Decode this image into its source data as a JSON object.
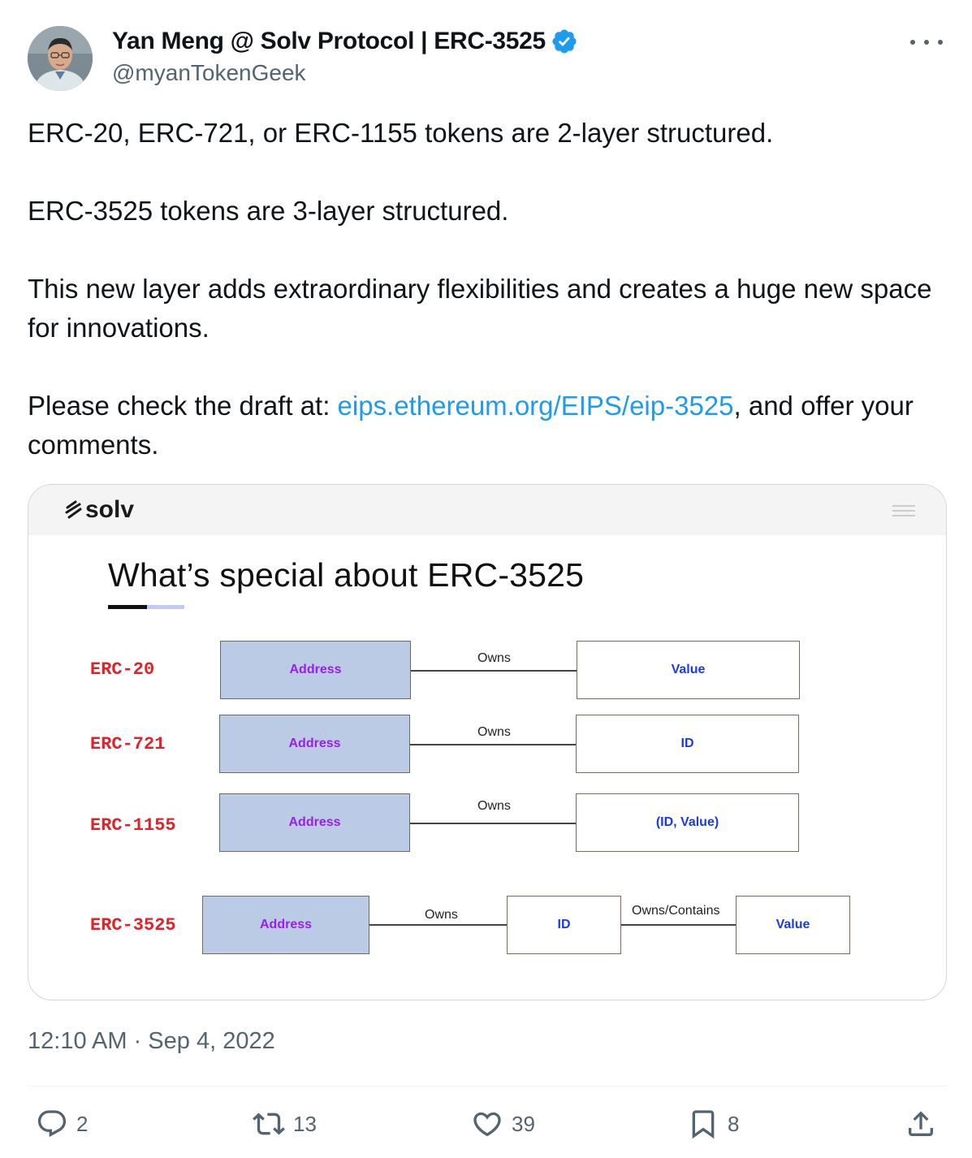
{
  "author": {
    "name": "Yan Meng @ Solv Protocol | ERC-3525",
    "handle": "@myanTokenGeek"
  },
  "tweet": {
    "p1": "ERC-20, ERC-721, or ERC-1155 tokens are 2-layer structured.",
    "p2": "ERC-3525 tokens are 3-layer structured.",
    "p3": "This new layer adds extraordinary flexibilities and creates a huge new space for innovations.",
    "p4_before": "Please check the draft at: ",
    "p4_link": "eips.ethereum.org/EIPS/eip-3525",
    "p4_after": ", and offer your comments."
  },
  "media": {
    "logo_text": "solv",
    "title": "What’s special about ERC-3525",
    "rows": [
      {
        "label": "ERC-20",
        "address": "Address",
        "relation": "Owns",
        "target": "Value"
      },
      {
        "label": "ERC-721",
        "address": "Address",
        "relation": "Owns",
        "target": "ID"
      },
      {
        "label": "ERC-1155",
        "address": "Address",
        "relation": "Owns",
        "target": "(ID, Value)"
      },
      {
        "label": "ERC-3525",
        "address": "Address",
        "relation": "Owns",
        "target": "ID",
        "relation2": "Owns/Contains",
        "target2": "Value"
      }
    ]
  },
  "timestamp": "12:10 AM · Sep 4, 2022",
  "actions": {
    "replies": "2",
    "retweets": "13",
    "likes": "39",
    "bookmarks": "8"
  },
  "colors": {
    "link": "#1d9bf0",
    "verified": "#1d9bf0",
    "erc_label": "#e0232a",
    "address_fill": "#bccbe5",
    "address_text": "#9a1ee8",
    "value_text": "#1a3ae8",
    "secondary_text": "#536471"
  }
}
